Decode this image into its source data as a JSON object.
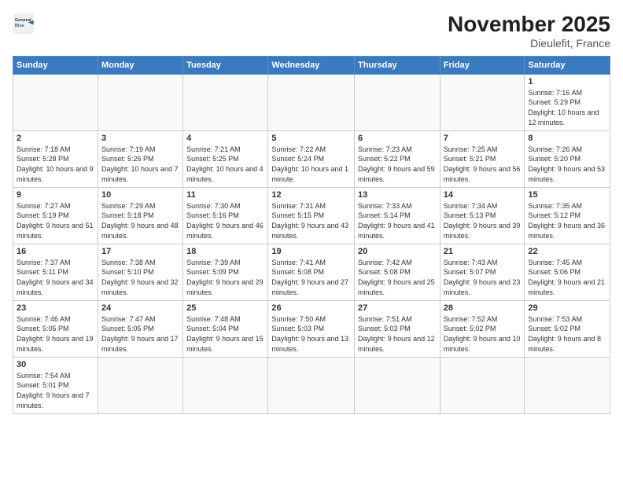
{
  "header": {
    "logo_general": "General",
    "logo_blue": "Blue",
    "month_title": "November 2025",
    "location": "Dieulefit, France"
  },
  "weekdays": [
    "Sunday",
    "Monday",
    "Tuesday",
    "Wednesday",
    "Thursday",
    "Friday",
    "Saturday"
  ],
  "weeks": [
    [
      {
        "day": "",
        "info": ""
      },
      {
        "day": "",
        "info": ""
      },
      {
        "day": "",
        "info": ""
      },
      {
        "day": "",
        "info": ""
      },
      {
        "day": "",
        "info": ""
      },
      {
        "day": "",
        "info": ""
      },
      {
        "day": "1",
        "info": "Sunrise: 7:16 AM\nSunset: 5:29 PM\nDaylight: 10 hours\nand 12 minutes."
      }
    ],
    [
      {
        "day": "2",
        "info": "Sunrise: 7:18 AM\nSunset: 5:28 PM\nDaylight: 10 hours\nand 9 minutes."
      },
      {
        "day": "3",
        "info": "Sunrise: 7:19 AM\nSunset: 5:26 PM\nDaylight: 10 hours\nand 7 minutes."
      },
      {
        "day": "4",
        "info": "Sunrise: 7:21 AM\nSunset: 5:25 PM\nDaylight: 10 hours\nand 4 minutes."
      },
      {
        "day": "5",
        "info": "Sunrise: 7:22 AM\nSunset: 5:24 PM\nDaylight: 10 hours\nand 1 minute."
      },
      {
        "day": "6",
        "info": "Sunrise: 7:23 AM\nSunset: 5:22 PM\nDaylight: 9 hours\nand 59 minutes."
      },
      {
        "day": "7",
        "info": "Sunrise: 7:25 AM\nSunset: 5:21 PM\nDaylight: 9 hours\nand 56 minutes."
      },
      {
        "day": "8",
        "info": "Sunrise: 7:26 AM\nSunset: 5:20 PM\nDaylight: 9 hours\nand 53 minutes."
      }
    ],
    [
      {
        "day": "9",
        "info": "Sunrise: 7:27 AM\nSunset: 5:19 PM\nDaylight: 9 hours\nand 51 minutes."
      },
      {
        "day": "10",
        "info": "Sunrise: 7:29 AM\nSunset: 5:18 PM\nDaylight: 9 hours\nand 48 minutes."
      },
      {
        "day": "11",
        "info": "Sunrise: 7:30 AM\nSunset: 5:16 PM\nDaylight: 9 hours\nand 46 minutes."
      },
      {
        "day": "12",
        "info": "Sunrise: 7:31 AM\nSunset: 5:15 PM\nDaylight: 9 hours\nand 43 minutes."
      },
      {
        "day": "13",
        "info": "Sunrise: 7:33 AM\nSunset: 5:14 PM\nDaylight: 9 hours\nand 41 minutes."
      },
      {
        "day": "14",
        "info": "Sunrise: 7:34 AM\nSunset: 5:13 PM\nDaylight: 9 hours\nand 39 minutes."
      },
      {
        "day": "15",
        "info": "Sunrise: 7:35 AM\nSunset: 5:12 PM\nDaylight: 9 hours\nand 36 minutes."
      }
    ],
    [
      {
        "day": "16",
        "info": "Sunrise: 7:37 AM\nSunset: 5:11 PM\nDaylight: 9 hours\nand 34 minutes."
      },
      {
        "day": "17",
        "info": "Sunrise: 7:38 AM\nSunset: 5:10 PM\nDaylight: 9 hours\nand 32 minutes."
      },
      {
        "day": "18",
        "info": "Sunrise: 7:39 AM\nSunset: 5:09 PM\nDaylight: 9 hours\nand 29 minutes."
      },
      {
        "day": "19",
        "info": "Sunrise: 7:41 AM\nSunset: 5:08 PM\nDaylight: 9 hours\nand 27 minutes."
      },
      {
        "day": "20",
        "info": "Sunrise: 7:42 AM\nSunset: 5:08 PM\nDaylight: 9 hours\nand 25 minutes."
      },
      {
        "day": "21",
        "info": "Sunrise: 7:43 AM\nSunset: 5:07 PM\nDaylight: 9 hours\nand 23 minutes."
      },
      {
        "day": "22",
        "info": "Sunrise: 7:45 AM\nSunset: 5:06 PM\nDaylight: 9 hours\nand 21 minutes."
      }
    ],
    [
      {
        "day": "23",
        "info": "Sunrise: 7:46 AM\nSunset: 5:05 PM\nDaylight: 9 hours\nand 19 minutes."
      },
      {
        "day": "24",
        "info": "Sunrise: 7:47 AM\nSunset: 5:05 PM\nDaylight: 9 hours\nand 17 minutes."
      },
      {
        "day": "25",
        "info": "Sunrise: 7:48 AM\nSunset: 5:04 PM\nDaylight: 9 hours\nand 15 minutes."
      },
      {
        "day": "26",
        "info": "Sunrise: 7:50 AM\nSunset: 5:03 PM\nDaylight: 9 hours\nand 13 minutes."
      },
      {
        "day": "27",
        "info": "Sunrise: 7:51 AM\nSunset: 5:03 PM\nDaylight: 9 hours\nand 12 minutes."
      },
      {
        "day": "28",
        "info": "Sunrise: 7:52 AM\nSunset: 5:02 PM\nDaylight: 9 hours\nand 10 minutes."
      },
      {
        "day": "29",
        "info": "Sunrise: 7:53 AM\nSunset: 5:02 PM\nDaylight: 9 hours\nand 8 minutes."
      }
    ],
    [
      {
        "day": "30",
        "info": "Sunrise: 7:54 AM\nSunset: 5:01 PM\nDaylight: 9 hours\nand 7 minutes."
      },
      {
        "day": "",
        "info": ""
      },
      {
        "day": "",
        "info": ""
      },
      {
        "day": "",
        "info": ""
      },
      {
        "day": "",
        "info": ""
      },
      {
        "day": "",
        "info": ""
      },
      {
        "day": "",
        "info": ""
      }
    ]
  ]
}
